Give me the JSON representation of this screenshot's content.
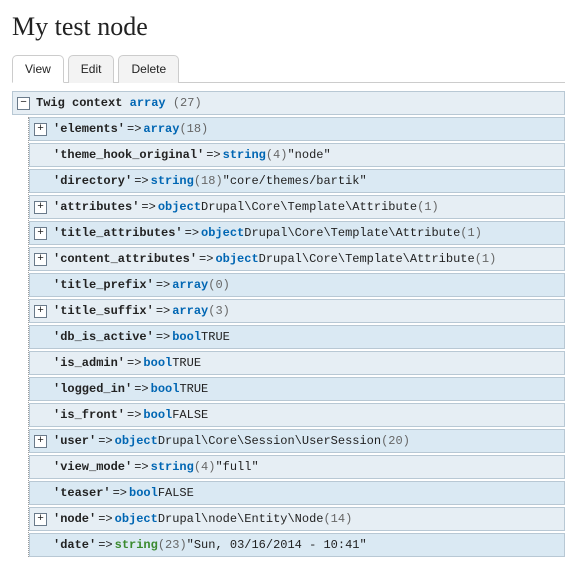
{
  "page_title": "My test node",
  "tabs": {
    "view": "View",
    "edit": "Edit",
    "delete": "Delete"
  },
  "root": {
    "label": "Twig context",
    "type": "array",
    "count": "(27)"
  },
  "rows": [
    {
      "expand": true,
      "key": "'elements'",
      "type": "array",
      "count": "(18)"
    },
    {
      "expand": false,
      "key": "'theme_hook_original'",
      "type": "string",
      "count": "(4)",
      "value": "\"node\""
    },
    {
      "expand": false,
      "key": "'directory'",
      "type": "string",
      "count": "(18)",
      "value": "\"core/themes/bartik\""
    },
    {
      "expand": true,
      "key": "'attributes'",
      "type": "object",
      "class": "Drupal\\Core\\Template\\Attribute",
      "count": "(1)"
    },
    {
      "expand": true,
      "key": "'title_attributes'",
      "type": "object",
      "class": "Drupal\\Core\\Template\\Attribute",
      "count": "(1)"
    },
    {
      "expand": true,
      "key": "'content_attributes'",
      "type": "object",
      "class": "Drupal\\Core\\Template\\Attribute",
      "count": "(1)"
    },
    {
      "expand": false,
      "key": "'title_prefix'",
      "type": "array",
      "count": "(0)"
    },
    {
      "expand": true,
      "key": "'title_suffix'",
      "type": "array",
      "count": "(3)"
    },
    {
      "expand": false,
      "key": "'db_is_active'",
      "type": "bool",
      "value": "TRUE"
    },
    {
      "expand": false,
      "key": "'is_admin'",
      "type": "bool",
      "value": "TRUE"
    },
    {
      "expand": false,
      "key": "'logged_in'",
      "type": "bool",
      "value": "TRUE"
    },
    {
      "expand": false,
      "key": "'is_front'",
      "type": "bool",
      "value": "FALSE"
    },
    {
      "expand": true,
      "key": "'user'",
      "type": "object",
      "class": "Drupal\\Core\\Session\\UserSession",
      "count": "(20)"
    },
    {
      "expand": false,
      "key": "'view_mode'",
      "type": "string",
      "count": "(4)",
      "value": "\"full\""
    },
    {
      "expand": false,
      "key": "'teaser'",
      "type": "bool",
      "value": "FALSE"
    },
    {
      "expand": true,
      "key": "'node'",
      "type": "object",
      "class": "Drupal\\node\\Entity\\Node",
      "count": "(14)"
    },
    {
      "expand": false,
      "key": "'date'",
      "type": "string_green",
      "count": "(23)",
      "value": "\"Sun, 03/16/2014 - 10:41\""
    }
  ]
}
